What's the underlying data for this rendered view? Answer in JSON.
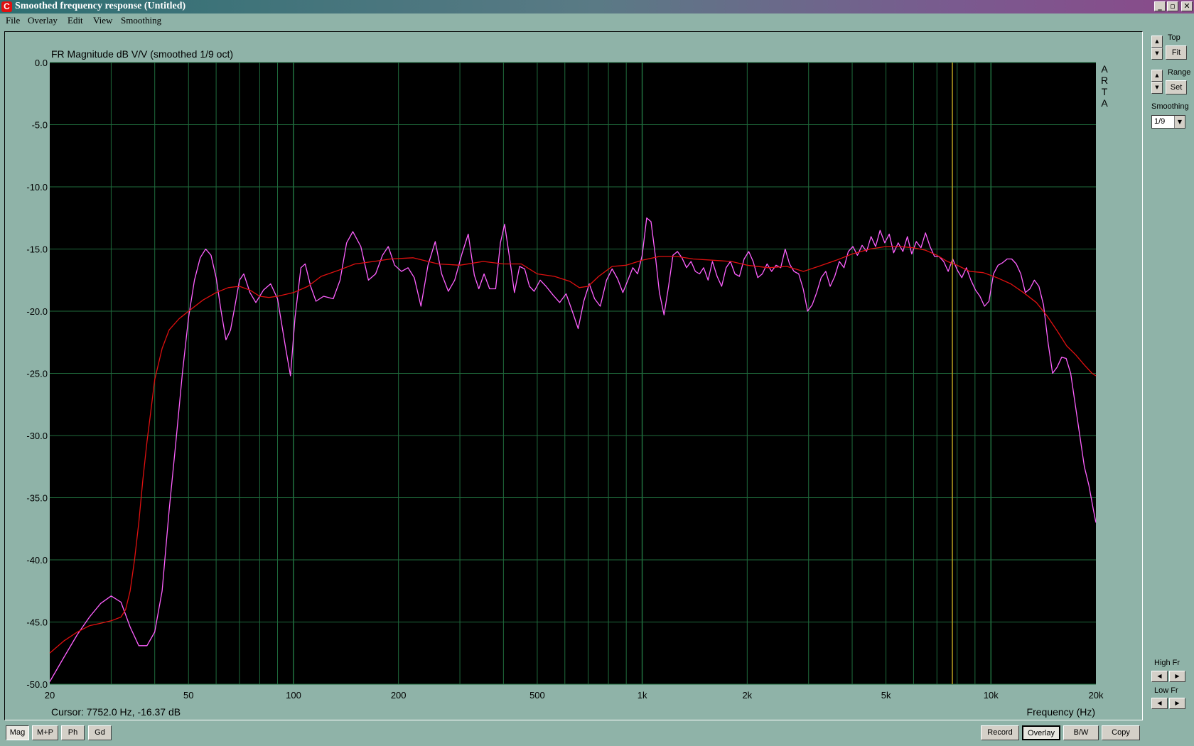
{
  "window": {
    "title": "Smoothed frequency response (Untitled)",
    "icon": "arta-app-icon",
    "icon_glyph": "C",
    "minimize": "_",
    "maximize": "▫",
    "close": "✕"
  },
  "menu": [
    "File",
    "Overlay",
    "Edit",
    "View",
    "Smoothing"
  ],
  "chart_data": {
    "type": "line",
    "title": "FR Magnitude dB V/V (smoothed 1/9 oct)",
    "xlabel": "Frequency (Hz)",
    "ylabel": "",
    "x_scale": "log",
    "xlim": [
      20,
      20000
    ],
    "ylim": [
      -50,
      0
    ],
    "xticks": [
      20,
      50,
      100,
      200,
      500,
      1000,
      2000,
      5000,
      10000,
      20000
    ],
    "xtick_labels": [
      "20",
      "50",
      "100",
      "200",
      "500",
      "1k",
      "2k",
      "5k",
      "10k",
      "20k"
    ],
    "yticks": [
      0,
      -5,
      -10,
      -15,
      -20,
      -25,
      -30,
      -35,
      -40,
      -45,
      -50
    ],
    "ytick_labels": [
      "0.0",
      "-5.0",
      "-10.0",
      "-15.0",
      "-20.0",
      "-25.0",
      "-30.0",
      "-35.0",
      "-40.0",
      "-45.0",
      "-50.0"
    ],
    "grid": true,
    "background": "#000000",
    "grid_color": "#1f6b3c",
    "watermark": "ARTA",
    "cursor_freq": 7752.0,
    "series": [
      {
        "color": "#ff60ff",
        "points": [
          [
            20,
            -49.8
          ],
          [
            22,
            -47.8
          ],
          [
            24,
            -46.0
          ],
          [
            26,
            -44.6
          ],
          [
            28,
            -43.5
          ],
          [
            30,
            -42.9
          ],
          [
            32,
            -43.4
          ],
          [
            34,
            -45.4
          ],
          [
            36,
            -46.9
          ],
          [
            38,
            -46.9
          ],
          [
            40,
            -45.8
          ],
          [
            42,
            -42.5
          ],
          [
            44,
            -36
          ],
          [
            46,
            -30.5
          ],
          [
            48,
            -25
          ],
          [
            50,
            -20.5
          ],
          [
            52,
            -17.5
          ],
          [
            54,
            -15.7
          ],
          [
            56,
            -15.0
          ],
          [
            58,
            -15.5
          ],
          [
            60,
            -17.3
          ],
          [
            62,
            -20
          ],
          [
            64,
            -22.3
          ],
          [
            66,
            -21.5
          ],
          [
            68,
            -19.5
          ],
          [
            70,
            -17.5
          ],
          [
            72,
            -17.0
          ],
          [
            75,
            -18.5
          ],
          [
            78,
            -19.3
          ],
          [
            82,
            -18.3
          ],
          [
            86,
            -17.8
          ],
          [
            90,
            -19
          ],
          [
            95,
            -23
          ],
          [
            98,
            -25.2
          ],
          [
            101,
            -20.5
          ],
          [
            105,
            -16.5
          ],
          [
            108,
            -16.2
          ],
          [
            112,
            -18
          ],
          [
            116,
            -19.2
          ],
          [
            122,
            -18.8
          ],
          [
            130,
            -19.0
          ],
          [
            136,
            -17.5
          ],
          [
            142,
            -14.5
          ],
          [
            148,
            -13.6
          ],
          [
            156,
            -14.8
          ],
          [
            164,
            -17.5
          ],
          [
            172,
            -17.0
          ],
          [
            180,
            -15.5
          ],
          [
            187,
            -14.8
          ],
          [
            195,
            -16.3
          ],
          [
            204,
            -16.8
          ],
          [
            213,
            -16.5
          ],
          [
            222,
            -17.3
          ],
          [
            232,
            -19.6
          ],
          [
            243,
            -16.3
          ],
          [
            255,
            -14.4
          ],
          [
            266,
            -17.0
          ],
          [
            278,
            -18.4
          ],
          [
            290,
            -17.5
          ],
          [
            304,
            -15.4
          ],
          [
            317,
            -13.8
          ],
          [
            330,
            -17.1
          ],
          [
            340,
            -18.2
          ],
          [
            352,
            -17.0
          ],
          [
            365,
            -18.2
          ],
          [
            380,
            -18.2
          ],
          [
            392,
            -14.5
          ],
          [
            403,
            -13.0
          ],
          [
            416,
            -15.6
          ],
          [
            430,
            -18.5
          ],
          [
            445,
            -16.4
          ],
          [
            460,
            -16.6
          ],
          [
            475,
            -18.0
          ],
          [
            490,
            -18.4
          ],
          [
            510,
            -17.5
          ],
          [
            530,
            -18.0
          ],
          [
            555,
            -18.7
          ],
          [
            580,
            -19.3
          ],
          [
            605,
            -18.6
          ],
          [
            630,
            -20.0
          ],
          [
            655,
            -21.4
          ],
          [
            680,
            -19.2
          ],
          [
            705,
            -17.8
          ],
          [
            730,
            -19.0
          ],
          [
            758,
            -19.6
          ],
          [
            790,
            -17.5
          ],
          [
            820,
            -16.6
          ],
          [
            850,
            -17.4
          ],
          [
            880,
            -18.5
          ],
          [
            910,
            -17.5
          ],
          [
            940,
            -16.5
          ],
          [
            970,
            -17.0
          ],
          [
            1000,
            -15.5
          ],
          [
            1030,
            -12.5
          ],
          [
            1060,
            -12.8
          ],
          [
            1090,
            -15.5
          ],
          [
            1120,
            -18.5
          ],
          [
            1155,
            -20.3
          ],
          [
            1190,
            -18.0
          ],
          [
            1225,
            -15.5
          ],
          [
            1262,
            -15.2
          ],
          [
            1300,
            -15.7
          ],
          [
            1340,
            -16.5
          ],
          [
            1380,
            -16.0
          ],
          [
            1420,
            -16.8
          ],
          [
            1460,
            -17.0
          ],
          [
            1500,
            -16.5
          ],
          [
            1545,
            -17.5
          ],
          [
            1590,
            -16.0
          ],
          [
            1640,
            -17.2
          ],
          [
            1690,
            -18.0
          ],
          [
            1740,
            -16.5
          ],
          [
            1790,
            -16.0
          ],
          [
            1845,
            -17.0
          ],
          [
            1900,
            -17.2
          ],
          [
            1960,
            -15.8
          ],
          [
            2020,
            -15.2
          ],
          [
            2080,
            -16.0
          ],
          [
            2145,
            -17.3
          ],
          [
            2210,
            -17.0
          ],
          [
            2280,
            -16.2
          ],
          [
            2350,
            -16.8
          ],
          [
            2420,
            -16.3
          ],
          [
            2495,
            -16.5
          ],
          [
            2570,
            -15.0
          ],
          [
            2645,
            -16.2
          ],
          [
            2725,
            -16.8
          ],
          [
            2810,
            -17.0
          ],
          [
            2895,
            -18.2
          ],
          [
            2980,
            -20.0
          ],
          [
            3070,
            -19.5
          ],
          [
            3165,
            -18.5
          ],
          [
            3260,
            -17.3
          ],
          [
            3360,
            -16.8
          ],
          [
            3460,
            -18.0
          ],
          [
            3565,
            -17.2
          ],
          [
            3675,
            -16.0
          ],
          [
            3790,
            -16.5
          ],
          [
            3900,
            -15.2
          ],
          [
            4020,
            -14.8
          ],
          [
            4140,
            -15.5
          ],
          [
            4270,
            -14.7
          ],
          [
            4400,
            -15.2
          ],
          [
            4530,
            -14.0
          ],
          [
            4670,
            -14.8
          ],
          [
            4810,
            -13.5
          ],
          [
            4960,
            -14.5
          ],
          [
            5110,
            -13.8
          ],
          [
            5260,
            -15.3
          ],
          [
            5420,
            -14.5
          ],
          [
            5590,
            -15.2
          ],
          [
            5760,
            -14.0
          ],
          [
            5930,
            -15.4
          ],
          [
            6110,
            -14.4
          ],
          [
            6300,
            -14.9
          ],
          [
            6490,
            -13.7
          ],
          [
            6690,
            -14.8
          ],
          [
            6890,
            -15.6
          ],
          [
            7100,
            -15.6
          ],
          [
            7320,
            -16.0
          ],
          [
            7540,
            -16.8
          ],
          [
            7770,
            -15.8
          ],
          [
            8010,
            -16.7
          ],
          [
            8250,
            -17.3
          ],
          [
            8500,
            -16.5
          ],
          [
            8760,
            -17.5
          ],
          [
            9030,
            -18.3
          ],
          [
            9300,
            -18.8
          ],
          [
            9580,
            -19.6
          ],
          [
            9870,
            -19.2
          ],
          [
            10170,
            -17.0
          ],
          [
            10480,
            -16.3
          ],
          [
            10800,
            -16.1
          ],
          [
            11130,
            -15.8
          ],
          [
            11470,
            -15.8
          ],
          [
            11820,
            -16.2
          ],
          [
            12180,
            -17.0
          ],
          [
            12550,
            -18.5
          ],
          [
            12930,
            -18.2
          ],
          [
            13320,
            -17.5
          ],
          [
            13730,
            -18.0
          ],
          [
            14150,
            -19.5
          ],
          [
            14580,
            -22.5
          ],
          [
            15020,
            -25.0
          ],
          [
            15480,
            -24.5
          ],
          [
            15950,
            -23.7
          ],
          [
            16430,
            -23.8
          ],
          [
            16930,
            -25.0
          ],
          [
            17450,
            -27.5
          ],
          [
            17980,
            -30.0
          ],
          [
            18530,
            -32.5
          ],
          [
            19090,
            -34.0
          ],
          [
            19670,
            -36.0
          ],
          [
            20000,
            -37.0
          ]
        ]
      },
      {
        "color": "#e01010",
        "points": [
          [
            20,
            -47.5
          ],
          [
            22,
            -46.5
          ],
          [
            24,
            -45.8
          ],
          [
            26,
            -45.3
          ],
          [
            28,
            -45.1
          ],
          [
            30,
            -44.9
          ],
          [
            32,
            -44.6
          ],
          [
            33,
            -44.0
          ],
          [
            34,
            -42.5
          ],
          [
            35,
            -40
          ],
          [
            36,
            -37
          ],
          [
            37,
            -33.5
          ],
          [
            38,
            -30.5
          ],
          [
            39,
            -28
          ],
          [
            40,
            -25.5
          ],
          [
            42,
            -23
          ],
          [
            44,
            -21.5
          ],
          [
            47,
            -20.6
          ],
          [
            50,
            -20.0
          ],
          [
            55,
            -19.1
          ],
          [
            60,
            -18.5
          ],
          [
            65,
            -18.1
          ],
          [
            70,
            -18.0
          ],
          [
            75,
            -18.3
          ],
          [
            80,
            -18.8
          ],
          [
            85,
            -18.9
          ],
          [
            90,
            -18.8
          ],
          [
            100,
            -18.5
          ],
          [
            110,
            -18.0
          ],
          [
            120,
            -17.2
          ],
          [
            135,
            -16.7
          ],
          [
            150,
            -16.2
          ],
          [
            170,
            -16.0
          ],
          [
            190,
            -15.8
          ],
          [
            220,
            -15.7
          ],
          [
            260,
            -16.2
          ],
          [
            300,
            -16.3
          ],
          [
            350,
            -16.0
          ],
          [
            400,
            -16.2
          ],
          [
            450,
            -16.2
          ],
          [
            500,
            -17.0
          ],
          [
            560,
            -17.2
          ],
          [
            620,
            -17.6
          ],
          [
            660,
            -18.1
          ],
          [
            700,
            -18.0
          ],
          [
            750,
            -17.2
          ],
          [
            820,
            -16.4
          ],
          [
            900,
            -16.3
          ],
          [
            1000,
            -15.9
          ],
          [
            1120,
            -15.6
          ],
          [
            1260,
            -15.6
          ],
          [
            1400,
            -15.8
          ],
          [
            1600,
            -15.9
          ],
          [
            1800,
            -16.0
          ],
          [
            2000,
            -16.3
          ],
          [
            2300,
            -16.5
          ],
          [
            2600,
            -16.4
          ],
          [
            2900,
            -16.8
          ],
          [
            3200,
            -16.4
          ],
          [
            3600,
            -15.9
          ],
          [
            4000,
            -15.4
          ],
          [
            4500,
            -15.0
          ],
          [
            5000,
            -14.8
          ],
          [
            5500,
            -14.8
          ],
          [
            6000,
            -14.9
          ],
          [
            6500,
            -15.1
          ],
          [
            7000,
            -15.5
          ],
          [
            7500,
            -16.0
          ],
          [
            8000,
            -16.3
          ],
          [
            8700,
            -16.8
          ],
          [
            9500,
            -16.9
          ],
          [
            10400,
            -17.3
          ],
          [
            11400,
            -17.8
          ],
          [
            12400,
            -18.5
          ],
          [
            13500,
            -19.3
          ],
          [
            14500,
            -20.4
          ],
          [
            15500,
            -21.6
          ],
          [
            16500,
            -22.8
          ],
          [
            17500,
            -23.5
          ],
          [
            18500,
            -24.3
          ],
          [
            19500,
            -25.0
          ],
          [
            20000,
            -25.2
          ]
        ]
      }
    ],
    "cursor_color": "#b8a020",
    "cursor_text": "Cursor: 7752.0 Hz, -16.37 dB"
  },
  "right_panel": {
    "top_label": "Top",
    "fit_button": "Fit",
    "range_label": "Range",
    "set_button": "Set",
    "smoothing_label": "Smoothing",
    "smoothing_value": "1/9",
    "high_fr_label": "High Fr",
    "low_fr_label": "Low Fr",
    "spin_up": "▲",
    "spin_down": "▼",
    "arrow_left": "◀",
    "arrow_right": "▶",
    "dropdown_arrow": "▼"
  },
  "bottom_left_buttons": [
    {
      "label": "Mag",
      "pressed": true
    },
    {
      "label": "M+P",
      "pressed": false
    },
    {
      "label": "Ph",
      "pressed": false
    },
    {
      "label": "Gd",
      "pressed": false
    }
  ],
  "bottom_right_buttons": [
    "Record",
    "Overlay",
    "B/W",
    "Copy"
  ]
}
